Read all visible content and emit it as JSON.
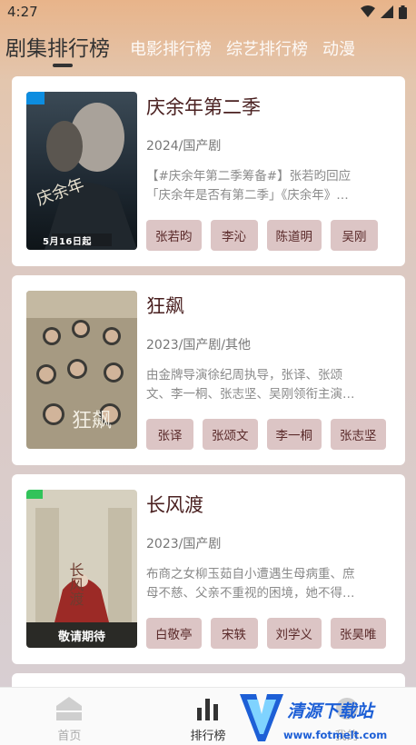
{
  "status_bar": {
    "time": "4:27"
  },
  "tabs": [
    {
      "label": "剧集排行榜",
      "active": true
    },
    {
      "label": "电影排行榜",
      "active": false
    },
    {
      "label": "综艺排行榜",
      "active": false
    },
    {
      "label": "动漫",
      "active": false
    }
  ],
  "items": [
    {
      "title": "庆余年第二季",
      "meta": "2024/国产剧",
      "desc_line1": "【#庆余年第二季筹备#】张若昀回应",
      "desc_line2": "「庆余年是否有第二季」《庆余年》…",
      "actors": [
        "张若昀",
        "李沁",
        "陈道明",
        "吴刚"
      ],
      "poster_text": "5月16日起",
      "poster_title": "庆余年"
    },
    {
      "title": "狂飙",
      "meta": "2023/国产剧/其他",
      "desc_line1": "由金牌导演徐纪周执导，张译、张颂",
      "desc_line2": "文、李一桐、张志坚、吴刚领衔主演…",
      "actors": [
        "张译",
        "张颂文",
        "李一桐",
        "张志坚"
      ],
      "poster_title": "狂飙"
    },
    {
      "title": "长风渡",
      "meta": "2023/国产剧",
      "desc_line1": "布商之女柳玉茹自小遭遇生母病重、庶",
      "desc_line2": "母不慈、父亲不重视的困境，她不得…",
      "actors": [
        "白敬亭",
        "宋轶",
        "刘学义",
        "张昊唯"
      ],
      "poster_text": "敬请期待",
      "poster_title": "长风渡"
    }
  ],
  "bottom_nav": [
    {
      "label": "首页",
      "icon": "home-icon",
      "active": false
    },
    {
      "label": "排行榜",
      "icon": "ranking-icon",
      "active": true
    },
    {
      "label": "我的",
      "icon": "profile-icon",
      "active": false
    }
  ],
  "watermark": {
    "name": "清源下载站",
    "url": "www.fotmelt.com"
  },
  "colors": {
    "accent": "#333333",
    "actor_chip": "#dcc5c5",
    "title": "#4a2020"
  }
}
